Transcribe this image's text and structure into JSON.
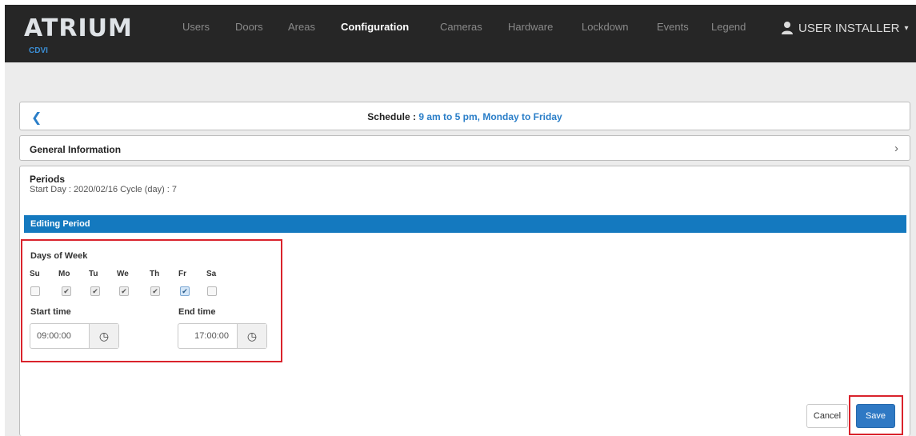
{
  "app": {
    "logo": "ATRIUM",
    "logo_sub": "CDVI",
    "nav": [
      "Users",
      "Doors",
      "Areas",
      "Configuration",
      "Cameras",
      "Hardware",
      "Lockdown",
      "Events",
      "Legend"
    ],
    "active_nav": "Configuration",
    "user": "USER INSTALLER"
  },
  "schedule": {
    "label": "Schedule :",
    "name": "9 am to 5 pm, Monday to Friday"
  },
  "general": {
    "label": "General Information"
  },
  "periods": {
    "title": "Periods",
    "info": "Start Day : 2020/02/16   Cycle (day) : 7"
  },
  "editing": {
    "header": "Editing Period",
    "days_title": "Days of Week",
    "days": [
      {
        "label": "Su",
        "checked": false
      },
      {
        "label": "Mo",
        "checked": true
      },
      {
        "label": "Tu",
        "checked": true
      },
      {
        "label": "We",
        "checked": true
      },
      {
        "label": "Th",
        "checked": true
      },
      {
        "label": "Fr",
        "checked": true
      },
      {
        "label": "Sa",
        "checked": false
      }
    ],
    "start_label": "Start time",
    "start_value": "09:00:00",
    "end_label": "End time",
    "end_value": "17:00:00"
  },
  "buttons": {
    "cancel": "Cancel",
    "save": "Save"
  },
  "colors": {
    "navbar": "#262626",
    "accent_blue": "#1479bf",
    "save_blue": "#2f79c4",
    "highlight_red": "#d9232c"
  }
}
